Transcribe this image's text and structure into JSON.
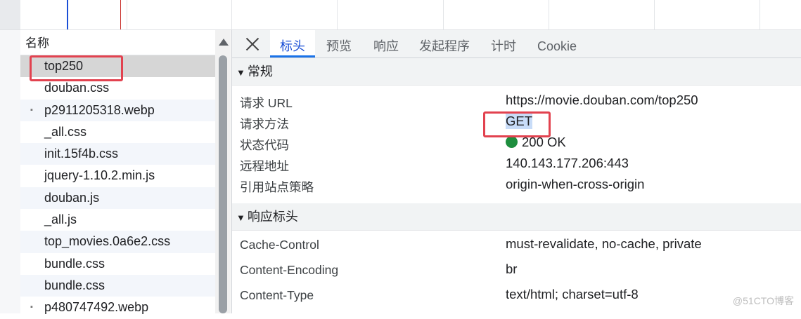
{
  "name_panel": {
    "header": "名称",
    "files": [
      {
        "name": "top250",
        "icon": "none",
        "selected": true
      },
      {
        "name": "douban.css",
        "icon": "none"
      },
      {
        "name": "p2911205318.webp",
        "icon": "image-icon"
      },
      {
        "name": "_all.css",
        "icon": "none"
      },
      {
        "name": "init.15f4b.css",
        "icon": "none"
      },
      {
        "name": "jquery-1.10.2.min.js",
        "icon": "none"
      },
      {
        "name": "douban.js",
        "icon": "none"
      },
      {
        "name": "_all.js",
        "icon": "none"
      },
      {
        "name": "top_movies.0a6e2.css",
        "icon": "none"
      },
      {
        "name": "bundle.css",
        "icon": "none"
      },
      {
        "name": "bundle.css",
        "icon": "none"
      },
      {
        "name": "p480747492.webp",
        "icon": "image-icon"
      }
    ]
  },
  "tabs": [
    "标头",
    "预览",
    "响应",
    "发起程序",
    "计时",
    "Cookie"
  ],
  "active_tab": "标头",
  "general": {
    "title": "常规",
    "rows": [
      {
        "key": "请求 URL",
        "value": "https://movie.douban.com/top250"
      },
      {
        "key": "请求方法",
        "value": "GET"
      },
      {
        "key": "状态代码",
        "value": "200 OK"
      },
      {
        "key": "远程地址",
        "value": "140.143.177.206:443"
      },
      {
        "key": "引用站点策略",
        "value": "origin-when-cross-origin"
      }
    ]
  },
  "response_headers": {
    "title": "响应标头",
    "rows": [
      {
        "key": "Cache-Control",
        "value": "must-revalidate, no-cache, private"
      },
      {
        "key": "Content-Encoding",
        "value": "br"
      },
      {
        "key": "Content-Type",
        "value": "text/html; charset=utf-8"
      }
    ]
  },
  "watermark": "@51CTO博客",
  "colors": {
    "accent": "#1a73e8",
    "highlight_box": "#e2424f",
    "status_ok": "#1e8e3e"
  }
}
